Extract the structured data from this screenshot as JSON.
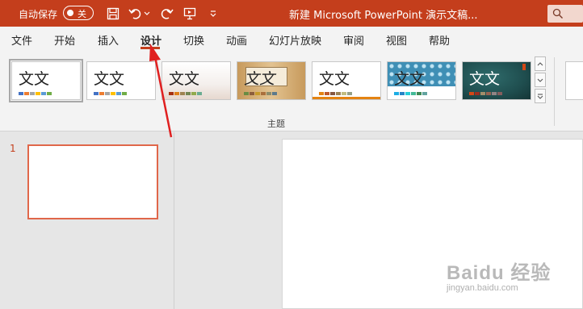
{
  "titlebar": {
    "autosave_label": "自动保存",
    "autosave_state": "关",
    "doc_title": "新建 Microsoft PowerPoint 演示文稿...",
    "quick_access": [
      "save-icon",
      "undo-icon",
      "redo-icon",
      "present-from-start-icon",
      "customize-quick-access-icon"
    ],
    "accent_color": "#c43e1c"
  },
  "tabs": [
    {
      "label": "文件"
    },
    {
      "label": "开始"
    },
    {
      "label": "插入"
    },
    {
      "label": "设计",
      "active": true
    },
    {
      "label": "切换"
    },
    {
      "label": "动画"
    },
    {
      "label": "幻灯片放映"
    },
    {
      "label": "审阅"
    },
    {
      "label": "视图"
    },
    {
      "label": "帮助"
    }
  ],
  "design_ribbon": {
    "group_label": "主题",
    "themes": [
      {
        "label": "文文",
        "background": "#ffffff",
        "swatches": [
          "#4472c4",
          "#ed7d31",
          "#a5a5a5",
          "#ffc000",
          "#5b9bd5",
          "#70ad47"
        ]
      },
      {
        "label": "文文",
        "background": "#ffffff",
        "swatches": [
          "#4472c4",
          "#ed7d31",
          "#a5a5a5",
          "#ffc000",
          "#5b9bd5",
          "#70ad47"
        ]
      },
      {
        "label": "文文",
        "background": "#f0ebe8",
        "swatches": [
          "#a53010",
          "#de7e18",
          "#9f8351",
          "#728653",
          "#92aa4c",
          "#6aac91"
        ]
      },
      {
        "label": "文文",
        "background": "#d7b27a",
        "swatches": [
          "#6a8c43",
          "#8c5d3b",
          "#c69a2a",
          "#aa6f3c",
          "#8c8c6a",
          "#5d7a8c"
        ]
      },
      {
        "label": "文文",
        "background": "#ffffff",
        "swatches": [
          "#e48312",
          "#bd582c",
          "#865640",
          "#9b8357",
          "#c2bc80",
          "#94a088"
        ]
      },
      {
        "label": "文文",
        "background": "#3f8fb5",
        "swatches": [
          "#1cade4",
          "#2683c6",
          "#27ced7",
          "#42ba97",
          "#3e8853",
          "#62a39f"
        ]
      },
      {
        "label": "文文",
        "background": "#1f4e4f",
        "swatches": [
          "#d34817",
          "#9b2d1f",
          "#a28e6a",
          "#956251",
          "#918485",
          "#855d5d"
        ]
      }
    ]
  },
  "slides_pane": {
    "slide_number": "1"
  },
  "watermark": {
    "main": "Baidu 经验",
    "sub": "jingyan.baidu.com"
  }
}
